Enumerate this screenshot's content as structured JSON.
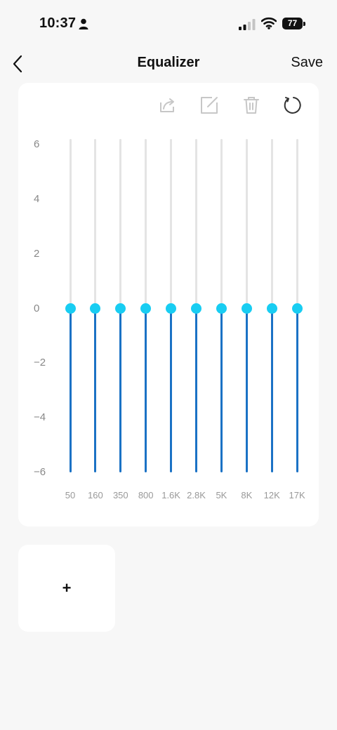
{
  "status_bar": {
    "time": "10:37",
    "battery": "77"
  },
  "nav": {
    "title": "Equalizer",
    "save_label": "Save"
  },
  "toolbar": {
    "icons": [
      "share-icon",
      "edit-icon",
      "trash-icon",
      "reset-icon"
    ]
  },
  "equalizer": {
    "y_ticks": [
      "6",
      "4",
      "2",
      "0",
      "−2",
      "−4",
      "−6"
    ],
    "y_range": [
      -6,
      6
    ],
    "bands": [
      {
        "label": "50",
        "gain": 0
      },
      {
        "label": "160",
        "gain": 0
      },
      {
        "label": "350",
        "gain": 0
      },
      {
        "label": "800",
        "gain": 0
      },
      {
        "label": "1.6K",
        "gain": 0
      },
      {
        "label": "2.8K",
        "gain": 0
      },
      {
        "label": "5K",
        "gain": 0
      },
      {
        "label": "8K",
        "gain": 0
      },
      {
        "label": "12K",
        "gain": 0
      },
      {
        "label": "17K",
        "gain": 0
      }
    ],
    "colors": {
      "track": "#e4e4e4",
      "fill": "#1b72c5",
      "knob": "#18cdf2"
    }
  },
  "presets": {
    "add_label": "+"
  }
}
